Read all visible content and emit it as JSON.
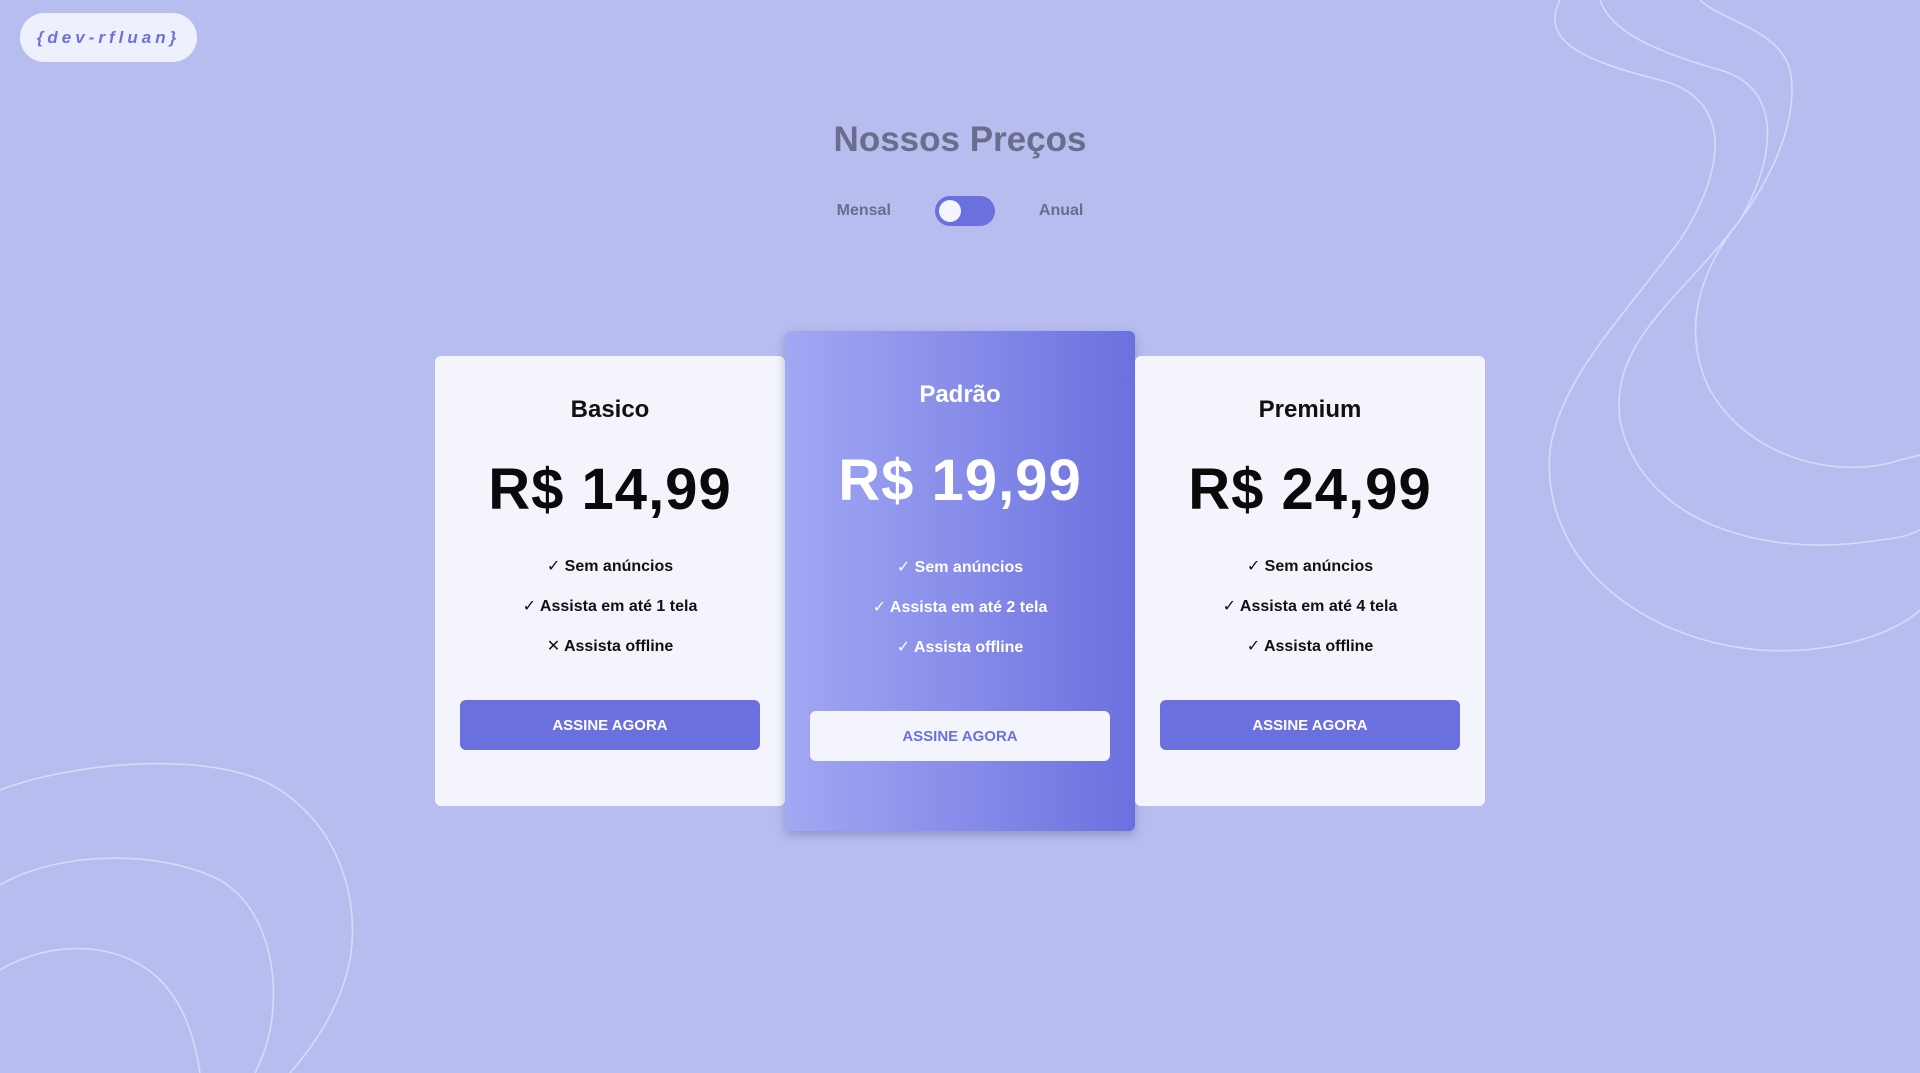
{
  "logo": {
    "text": "{dev-rfluan}"
  },
  "header": {
    "title": "Nossos Preços"
  },
  "billing_toggle": {
    "left_label": "Mensal",
    "right_label": "Anual",
    "selected": "Mensal"
  },
  "colors": {
    "background": "#b8bdf0",
    "accent": "#6b70df",
    "card": "#f4f5fc",
    "title_text": "#6a6d8c"
  },
  "plans": [
    {
      "name": "Basico",
      "price": "R$ 14,99",
      "features": [
        "✓ Sem anúncios",
        "✓ Assista em até 1 tela",
        "✕ Assista offline"
      ],
      "cta": "ASSINE AGORA"
    },
    {
      "name": "Padrão",
      "price": "R$ 19,99",
      "features": [
        "✓ Sem anúncios",
        "✓ Assista em até 2 tela",
        "✓ Assista offline"
      ],
      "cta": "ASSINE AGORA"
    },
    {
      "name": "Premium",
      "price": "R$ 24,99",
      "features": [
        "✓ Sem anúncios",
        "✓ Assista em até 4 tela",
        "✓ Assista offline"
      ],
      "cta": "ASSINE AGORA"
    }
  ]
}
